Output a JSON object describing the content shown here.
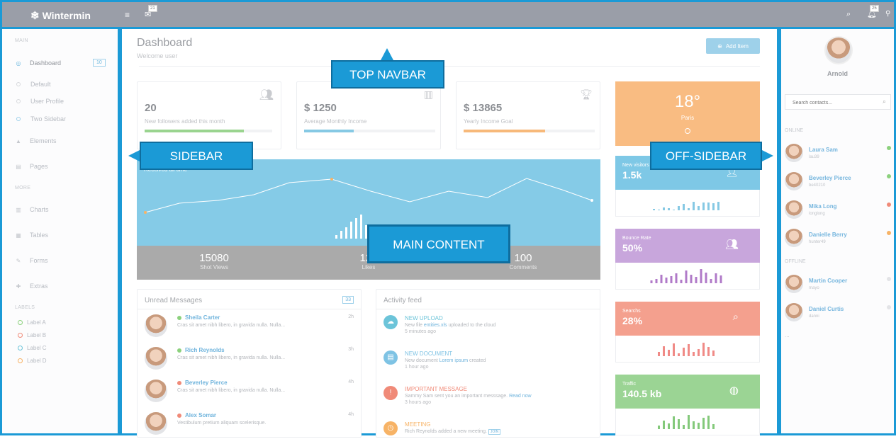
{
  "app": {
    "brand": "Wintermin",
    "logo_icon": "snowflake-icon"
  },
  "topnav": {
    "mail_badge": "21",
    "bell_badge": "25"
  },
  "sidebar": {
    "section_main": "MAIN",
    "dashboard_label": "Dashboard",
    "dashboard_badge": "10",
    "sub_items": [
      "Default",
      "User Profile",
      "Two Sidebar"
    ],
    "elements_label": "Elements",
    "pages_label": "Pages",
    "section_more": "MORE",
    "more_items": [
      "Charts",
      "Tables",
      "Forms",
      "Extras"
    ],
    "section_labels": "LABELS",
    "labels": [
      {
        "text": "Label A",
        "color": "#8cd17d"
      },
      {
        "text": "Label B",
        "color": "#f08a78"
      },
      {
        "text": "Label C",
        "color": "#6cc4d9"
      },
      {
        "text": "Label D",
        "color": "#f7b366"
      }
    ]
  },
  "header": {
    "title": "Dashboard",
    "subtitle": "Welcome user",
    "add_button": "Add Item"
  },
  "stats": [
    {
      "value": "20",
      "label": "New followers added this month",
      "progress": 0.78,
      "color": "#9ad48f",
      "icon": "users-icon"
    },
    {
      "value": "$ 1250",
      "label": "Average Monthly Income",
      "progress": 0.38,
      "color": "#86c9e4",
      "icon": "bar-chart-icon"
    },
    {
      "value": "$ 13865",
      "label": "Yearly Income Goal",
      "progress": 0.62,
      "color": "#f7b97a",
      "icon": "trophy-icon"
    }
  ],
  "big_chart": {
    "title": "Received all time",
    "footer": [
      {
        "value": "15080",
        "label": "Shot Views"
      },
      {
        "value": "120",
        "label": "Likes"
      },
      {
        "value": "100",
        "label": "Comments"
      }
    ]
  },
  "messages": {
    "title": "Unread Messages",
    "count": "33",
    "items": [
      {
        "name": "Sheila Carter",
        "text": "Cras sit amet nibh libero, in gravida nulla. Nulla...",
        "time": "2h",
        "status": "#8cd17d"
      },
      {
        "name": "Rich Reynolds",
        "text": "Cras sit amet nibh libero, in gravida nulla. Nulla...",
        "time": "3h",
        "status": "#8cd17d"
      },
      {
        "name": "Beverley Pierce",
        "text": "Cras sit amet nibh libero, in gravida nulla. Nulla...",
        "time": "4h",
        "status": "#f08a78"
      },
      {
        "name": "Alex Somar",
        "text": "Vestibulum pretium aliquam scelerisque.",
        "time": "4h",
        "status": "#f08a78"
      }
    ]
  },
  "activity": {
    "title": "Activity feed",
    "items": [
      {
        "title": "NEW UPLOAD",
        "pre": "New file ",
        "link": "entities.xls",
        "post": " uploaded to the cloud",
        "time": "5 minutes ago",
        "color": "#6cc4d9",
        "icon": "cloud-upload-icon"
      },
      {
        "title": "NEW DOCUMENT",
        "pre": "New document ",
        "link": "Lorem ipsum",
        "post": " created",
        "time": "1 hour ago",
        "color": "#7ec3e4",
        "icon": "document-icon"
      },
      {
        "title": "IMPORTANT MESSAGE",
        "pre": "Sammy Sam sent you an important messsage. ",
        "link": "Read now",
        "post": "",
        "time": "3 hours ago",
        "color": "#f08a78",
        "icon": "exclamation-icon"
      },
      {
        "title": "MEETING",
        "pre": "Rich Reynolds added a new meeting. ",
        "link": "",
        "post": "",
        "time": "",
        "color": "#f7b366",
        "icon": "clock-icon",
        "tag": "JOIN"
      }
    ]
  },
  "weather": {
    "temp": "18°",
    "city": "Paris"
  },
  "tiles": [
    {
      "label": "New visitors",
      "value": "1.5k",
      "color": "#7ec8e6",
      "bar_color": "#86c9e4",
      "icon": "user-add-icon"
    },
    {
      "label": "Bounce Rate",
      "value": "50%",
      "color": "#c8a6dc",
      "bar_color": "#b07ac8",
      "icon": "users-icon"
    },
    {
      "label": "Searchs",
      "value": "28%",
      "color": "#f4a08e",
      "bar_color": "#f08a86",
      "icon": "search-icon"
    },
    {
      "label": "Traffic",
      "value": "140.5 kb",
      "color": "#9bd494",
      "bar_color": "#84c97b",
      "icon": "globe-icon"
    }
  ],
  "offsidebar": {
    "user": "Arnold",
    "search_placeholder": "Search contacts...",
    "online_label": "ONLINE",
    "offline_label": "OFFLINE",
    "online": [
      {
        "name": "Laura Sam",
        "user": "lau39",
        "status": "#8cd17d"
      },
      {
        "name": "Beverley Pierce",
        "user": "be40210",
        "status": "#8cd17d"
      },
      {
        "name": "Mika Long",
        "user": "longlong",
        "status": "#f08a78"
      },
      {
        "name": "Danielle Berry",
        "user": "hunter49",
        "status": "#f7b366"
      }
    ],
    "offline": [
      {
        "name": "Martin Cooper",
        "user": "mayo",
        "status": "#e3e4e7"
      },
      {
        "name": "Daniel Curtis",
        "user": "danni",
        "status": "#e3e4e7"
      }
    ],
    "more": "..."
  },
  "callouts": {
    "sidebar": "SIDEBAR",
    "topnav": "TOP NAVBAR",
    "main": "MAIN CONTENT",
    "offsidebar": "OFF-SIDEBAR"
  }
}
